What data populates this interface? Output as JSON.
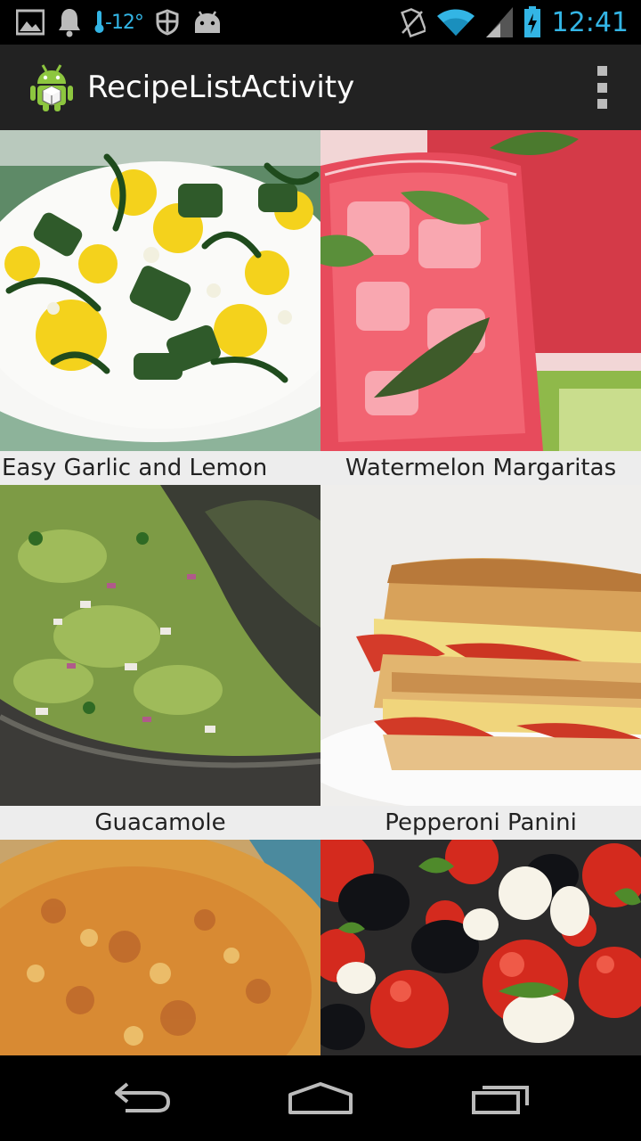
{
  "status_bar": {
    "temperature": "-12°",
    "time": "12:41",
    "icons": [
      "image-icon",
      "bell-icon",
      "shield-icon",
      "android-icon",
      "no-sim-icon",
      "wifi-icon",
      "signal-icon",
      "battery-icon"
    ]
  },
  "action_bar": {
    "title": "RecipeListActivity",
    "app_icon": "android-app-icon",
    "overflow_icon": "overflow-menu-icon"
  },
  "recipes": [
    {
      "name": "Easy Garlic and Lemon",
      "photo": "zucchini-salad"
    },
    {
      "name": "Watermelon Margaritas",
      "photo": "pink-drink-with-mint"
    },
    {
      "name": "Guacamole",
      "photo": "guacamole-in-molcajete"
    },
    {
      "name": "Pepperoni Panini",
      "photo": "pepperoni-sandwich"
    },
    {
      "name": "",
      "photo": "golden-flatbread"
    },
    {
      "name": "",
      "photo": "caprese-tomato-salad"
    }
  ],
  "nav_bar": {
    "icons": [
      "back-icon",
      "home-icon",
      "recent-apps-icon"
    ]
  },
  "colors": {
    "accent": "#33b5e5",
    "action_bar": "#222222",
    "caption_bg": "#ededed"
  }
}
